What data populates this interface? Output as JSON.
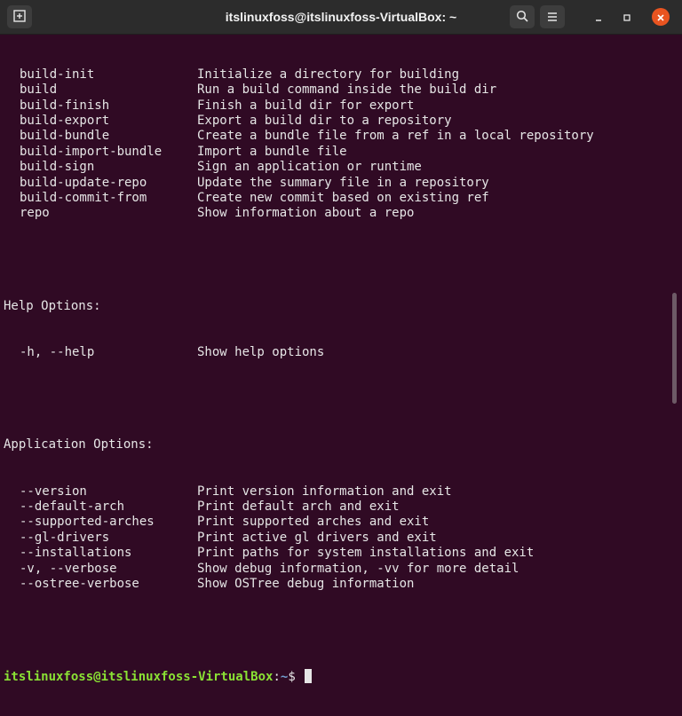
{
  "window": {
    "title": "itslinuxfoss@itslinuxfoss-VirtualBox: ~"
  },
  "icons": {
    "new_tab": "new-tab-icon",
    "search": "search-icon",
    "menu": "hamburger-menu-icon",
    "minimize": "minimize-icon",
    "maximize": "maximize-icon",
    "close": "close-icon"
  },
  "colors": {
    "terminal_bg": "#300a24",
    "close_button": "#e95420",
    "prompt_user": "#8ae234",
    "prompt_path": "#729fcf"
  },
  "build_commands": [
    {
      "cmd": "build-init",
      "desc": "Initialize a directory for building"
    },
    {
      "cmd": "build",
      "desc": "Run a build command inside the build dir"
    },
    {
      "cmd": "build-finish",
      "desc": "Finish a build dir for export"
    },
    {
      "cmd": "build-export",
      "desc": "Export a build dir to a repository"
    },
    {
      "cmd": "build-bundle",
      "desc": "Create a bundle file from a ref in a local repository"
    },
    {
      "cmd": "build-import-bundle",
      "desc": "Import a bundle file"
    },
    {
      "cmd": "build-sign",
      "desc": "Sign an application or runtime"
    },
    {
      "cmd": "build-update-repo",
      "desc": "Update the summary file in a repository"
    },
    {
      "cmd": "build-commit-from",
      "desc": "Create new commit based on existing ref"
    },
    {
      "cmd": "repo",
      "desc": "Show information about a repo"
    }
  ],
  "help_section": {
    "heading": "Help Options:",
    "options": [
      {
        "cmd": "-h, --help",
        "desc": "Show help options"
      }
    ]
  },
  "app_section": {
    "heading": "Application Options:",
    "options": [
      {
        "cmd": "--version",
        "desc": "Print version information and exit"
      },
      {
        "cmd": "--default-arch",
        "desc": "Print default arch and exit"
      },
      {
        "cmd": "--supported-arches",
        "desc": "Print supported arches and exit"
      },
      {
        "cmd": "--gl-drivers",
        "desc": "Print active gl drivers and exit"
      },
      {
        "cmd": "--installations",
        "desc": "Print paths for system installations and exit"
      },
      {
        "cmd": "-v, --verbose",
        "desc": "Show debug information, -vv for more detail"
      },
      {
        "cmd": "--ostree-verbose",
        "desc": "Show OSTree debug information"
      }
    ]
  },
  "prompt": {
    "user_host": "itslinuxfoss@itslinuxfoss-VirtualBox",
    "separator": ":",
    "path": "~",
    "symbol": "$ "
  }
}
